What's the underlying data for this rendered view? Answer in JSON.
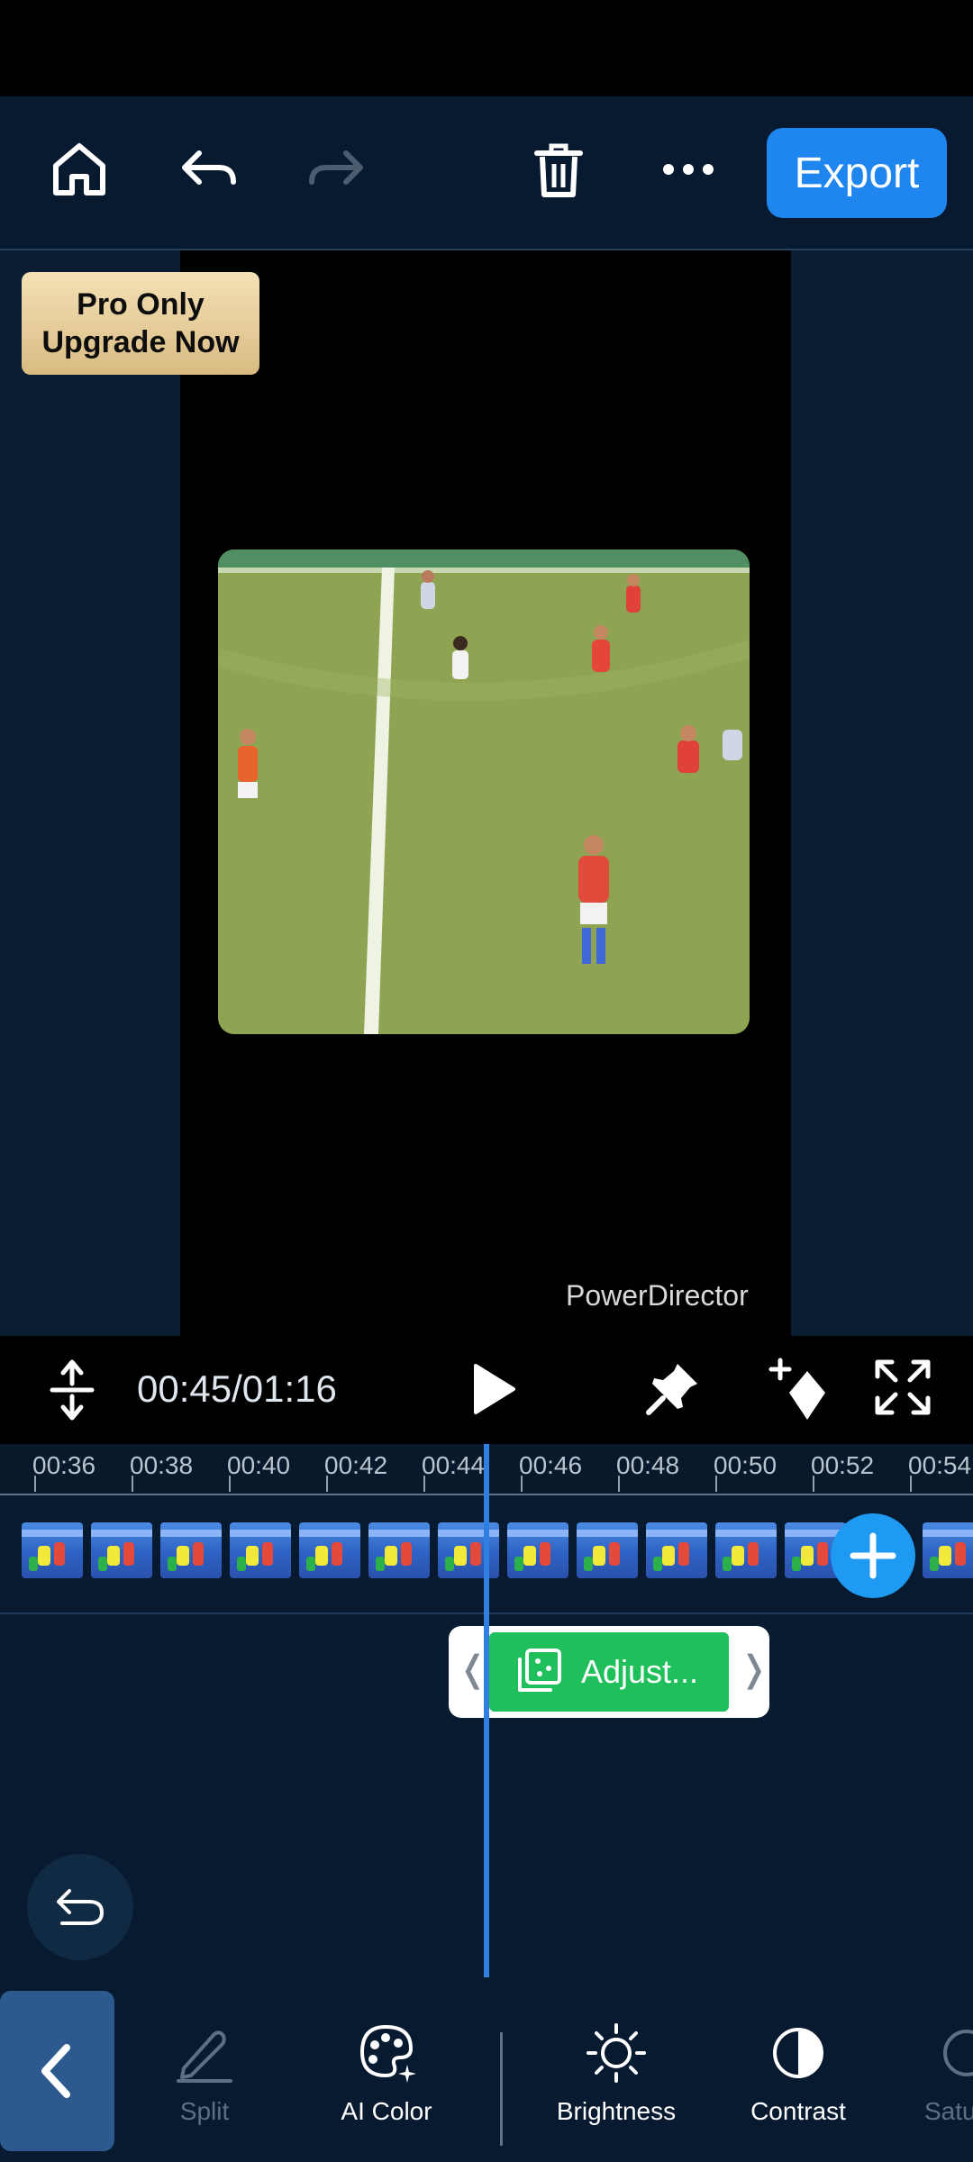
{
  "topbar": {
    "export_label": "Export",
    "icons": [
      "home-icon",
      "undo-icon",
      "redo-icon",
      "trash-icon",
      "more-icon"
    ]
  },
  "preview": {
    "pro_badge_line1": "Pro Only",
    "pro_badge_line2": "Upgrade Now",
    "watermark": "PowerDirector"
  },
  "controls": {
    "time": "00:45/01:16"
  },
  "timeline": {
    "ticks": [
      "00:36",
      "00:38",
      "00:40",
      "00:42",
      "00:44",
      "00:46",
      "00:48",
      "00:50",
      "00:52",
      "00:54"
    ],
    "adjust_label": "Adjust..."
  },
  "toolbar": {
    "split": "Split",
    "ai_color": "AI Color",
    "brightness": "Brightness",
    "contrast": "Contrast",
    "saturation": "Satu"
  },
  "colors": {
    "accent": "#1f86f0",
    "adjust_clip": "#1fbf5b",
    "background": "#071a2f"
  }
}
